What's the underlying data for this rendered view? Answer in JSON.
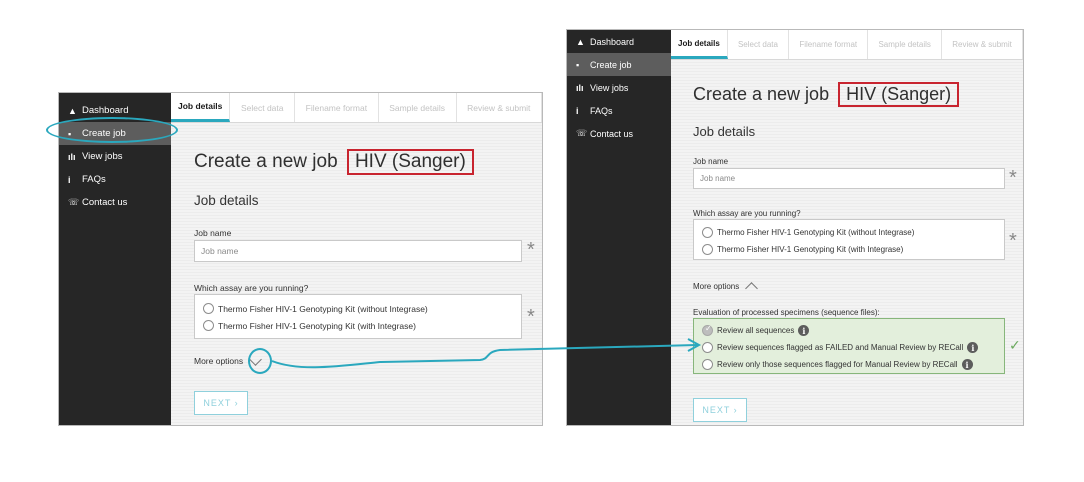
{
  "nav": {
    "items": [
      {
        "icon": "▲",
        "label": "Dashboard"
      },
      {
        "icon": "▪",
        "label": "Create job"
      },
      {
        "icon": "ılı",
        "label": "View jobs"
      },
      {
        "icon": "i",
        "label": "FAQs"
      },
      {
        "icon": "☏",
        "label": "Contact us"
      }
    ]
  },
  "tabs": [
    "Job details",
    "Select data",
    "Filename format",
    "Sample details",
    "Review & submit"
  ],
  "page": {
    "title": "Create a new job",
    "title_highlight": "HIV (Sanger)",
    "section_title": "Job details",
    "job_name_label": "Job name",
    "job_name_placeholder": "Job name",
    "assay_label": "Which assay are you running?",
    "assay_options": [
      "Thermo Fisher HIV-1 Genotyping Kit (without Integrase)",
      "Thermo Fisher HIV-1 Genotyping Kit (with Integrase)"
    ],
    "more_options": "More options",
    "required_mark": "*",
    "next_button": "NEXT ›"
  },
  "evaluation": {
    "label": "Evaluation of processed specimens (sequence files):",
    "options": [
      "Review all sequences",
      "Review sequences flagged as FAILED and Manual Review by RECall",
      "Review only those sequences flagged for Manual Review by RECall"
    ],
    "selected_index": 0,
    "valid_mark": "✓"
  },
  "colors": {
    "accent": "#2aa8be",
    "highlight_border": "#c8242f",
    "sidebar_bg": "#262626",
    "valid_green": "#6aa85d"
  },
  "icons": {
    "info": "i"
  }
}
